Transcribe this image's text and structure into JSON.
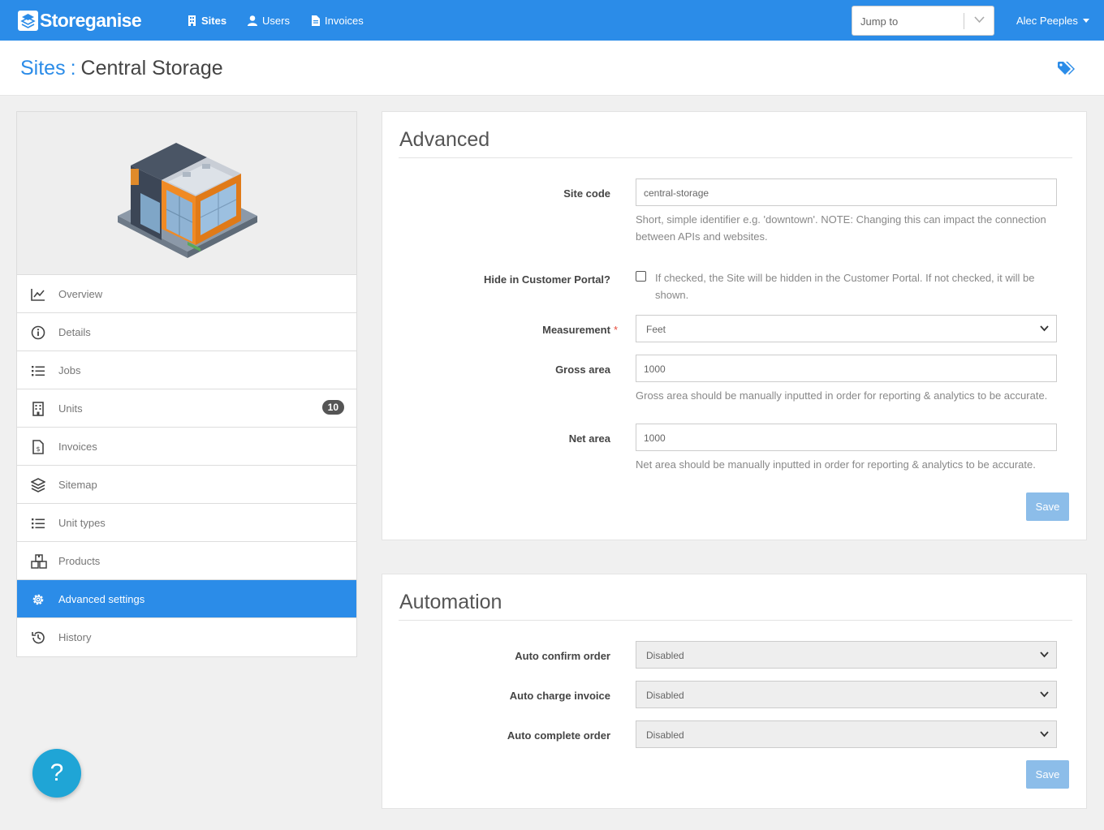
{
  "brand": {
    "name": "Storeganise"
  },
  "nav": {
    "items": [
      {
        "label": "Sites",
        "icon": "building-icon"
      },
      {
        "label": "Users",
        "icon": "user-icon"
      },
      {
        "label": "Invoices",
        "icon": "file-icon"
      }
    ],
    "jump_placeholder": "Jump to",
    "user_name": "Alec Peeples"
  },
  "breadcrumb": {
    "parent": "Sites",
    "separator": ":",
    "current": "Central Storage"
  },
  "sidebar": {
    "items": [
      {
        "label": "Overview",
        "icon": "chart-line-icon"
      },
      {
        "label": "Details",
        "icon": "info-icon"
      },
      {
        "label": "Jobs",
        "icon": "list-icon"
      },
      {
        "label": "Units",
        "icon": "building-icon",
        "badge": "10"
      },
      {
        "label": "Invoices",
        "icon": "invoice-icon"
      },
      {
        "label": "Sitemap",
        "icon": "layers-icon"
      },
      {
        "label": "Unit types",
        "icon": "list-icon"
      },
      {
        "label": "Products",
        "icon": "boxes-icon"
      },
      {
        "label": "Advanced settings",
        "icon": "gear-icon",
        "active": true
      },
      {
        "label": "History",
        "icon": "history-icon"
      }
    ]
  },
  "advanced": {
    "title": "Advanced",
    "site_code": {
      "label": "Site code",
      "value": "central-storage",
      "help": "Short, simple identifier e.g. 'downtown'. NOTE: Changing this can impact the connection between APIs and websites."
    },
    "hide_portal": {
      "label": "Hide in Customer Portal?",
      "checked": false,
      "help": "If checked, the Site will be hidden in the Customer Portal. If not checked, it will be shown."
    },
    "measurement": {
      "label": "Measurement",
      "required": "*",
      "value": "Feet"
    },
    "gross_area": {
      "label": "Gross area",
      "value": "1000",
      "help": "Gross area should be manually inputted in order for reporting & analytics to be accurate."
    },
    "net_area": {
      "label": "Net area",
      "value": "1000",
      "help": "Net area should be manually inputted in order for reporting & analytics to be accurate."
    },
    "save_label": "Save"
  },
  "automation": {
    "title": "Automation",
    "auto_confirm": {
      "label": "Auto confirm order",
      "value": "Disabled"
    },
    "auto_charge": {
      "label": "Auto charge invoice",
      "value": "Disabled"
    },
    "auto_complete": {
      "label": "Auto complete order",
      "value": "Disabled"
    },
    "save_label": "Save"
  },
  "help_button": {
    "label": "?"
  },
  "colors": {
    "primary": "#2b8ce8",
    "fab": "#1fa5d6",
    "button_disabled": "#8cbde9"
  }
}
